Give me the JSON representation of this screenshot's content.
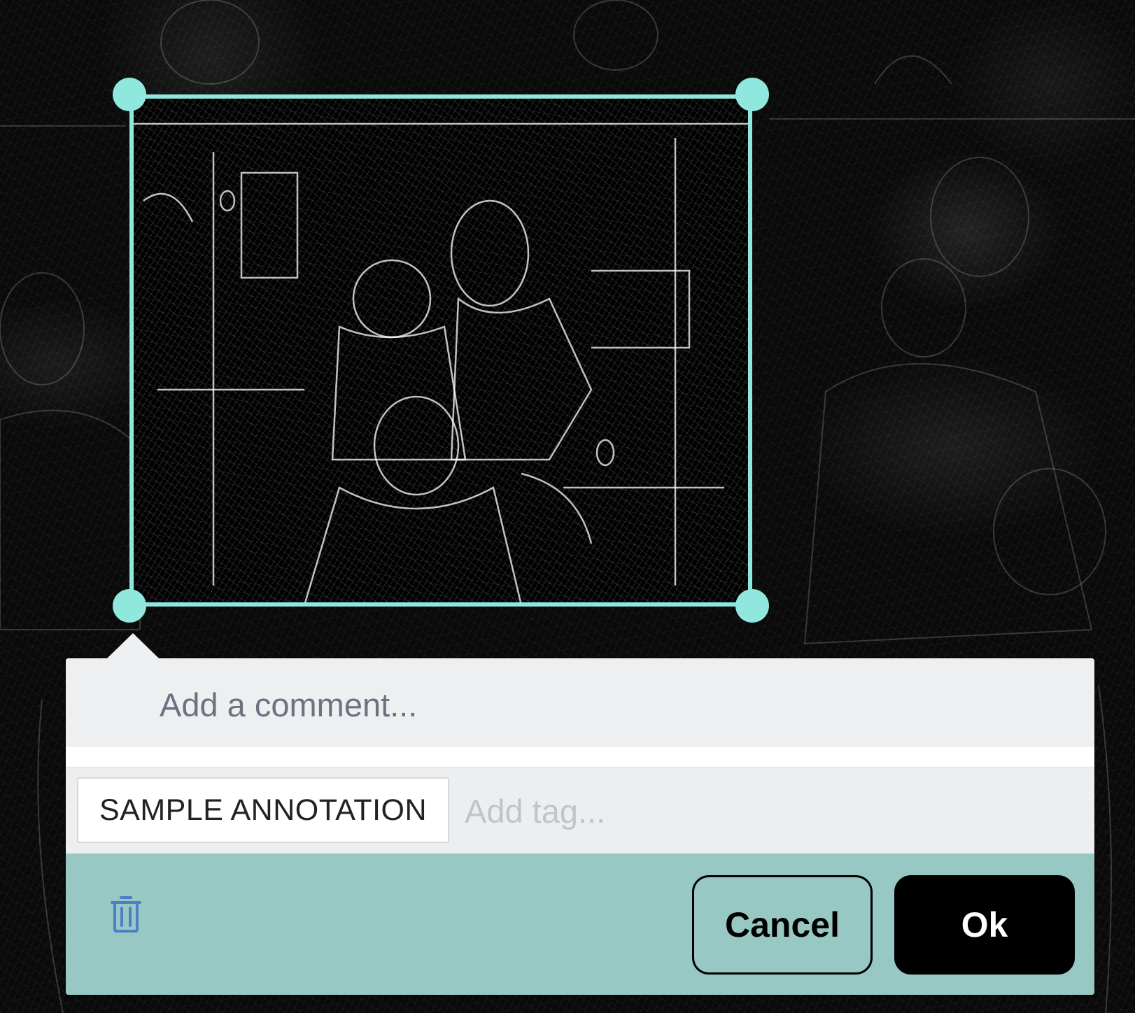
{
  "editor": {
    "comment_placeholder": "Add a comment...",
    "tag_chip": "SAMPLE ANNOTATION",
    "tag_placeholder": "Add tag...",
    "cancel_label": "Cancel",
    "ok_label": "Ok",
    "delete_icon": "trash-icon"
  },
  "colors": {
    "selection": "#8fe7dd",
    "footer": "#98c8c3",
    "ok_button": "#000000"
  }
}
